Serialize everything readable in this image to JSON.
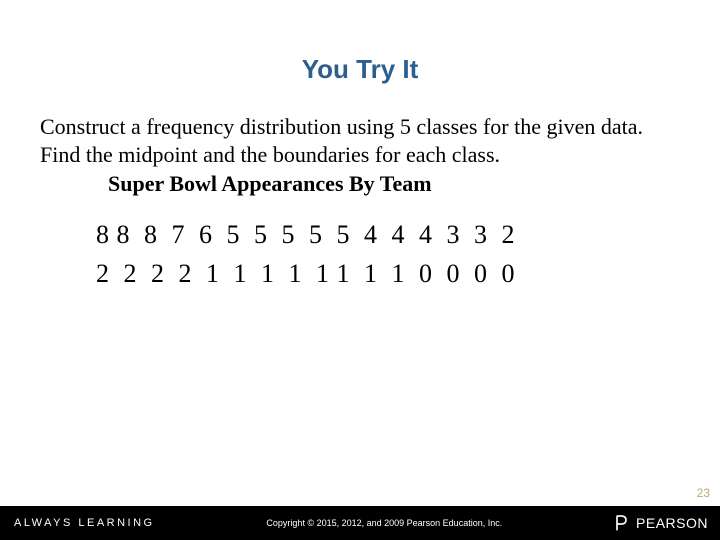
{
  "title": "You Try It",
  "instructions": "Construct a frequency distribution using 5 classes for the given data.  Find the midpoint and the boundaries for each class.",
  "subtitle": "Super Bowl Appearances By Team",
  "data_rows": [
    "8 8  8  7  6  5  5  5  5  5  4  4  4  3  3  2",
    "2  2  2  2  1  1  1  1  1 1  1  1  0  0  0  0"
  ],
  "footer": {
    "left": "ALWAYS LEARNING",
    "copyright": "Copyright © 2015, 2012, and 2009 Pearson Education, Inc.",
    "brand": "PEARSON"
  },
  "page_number": "23"
}
